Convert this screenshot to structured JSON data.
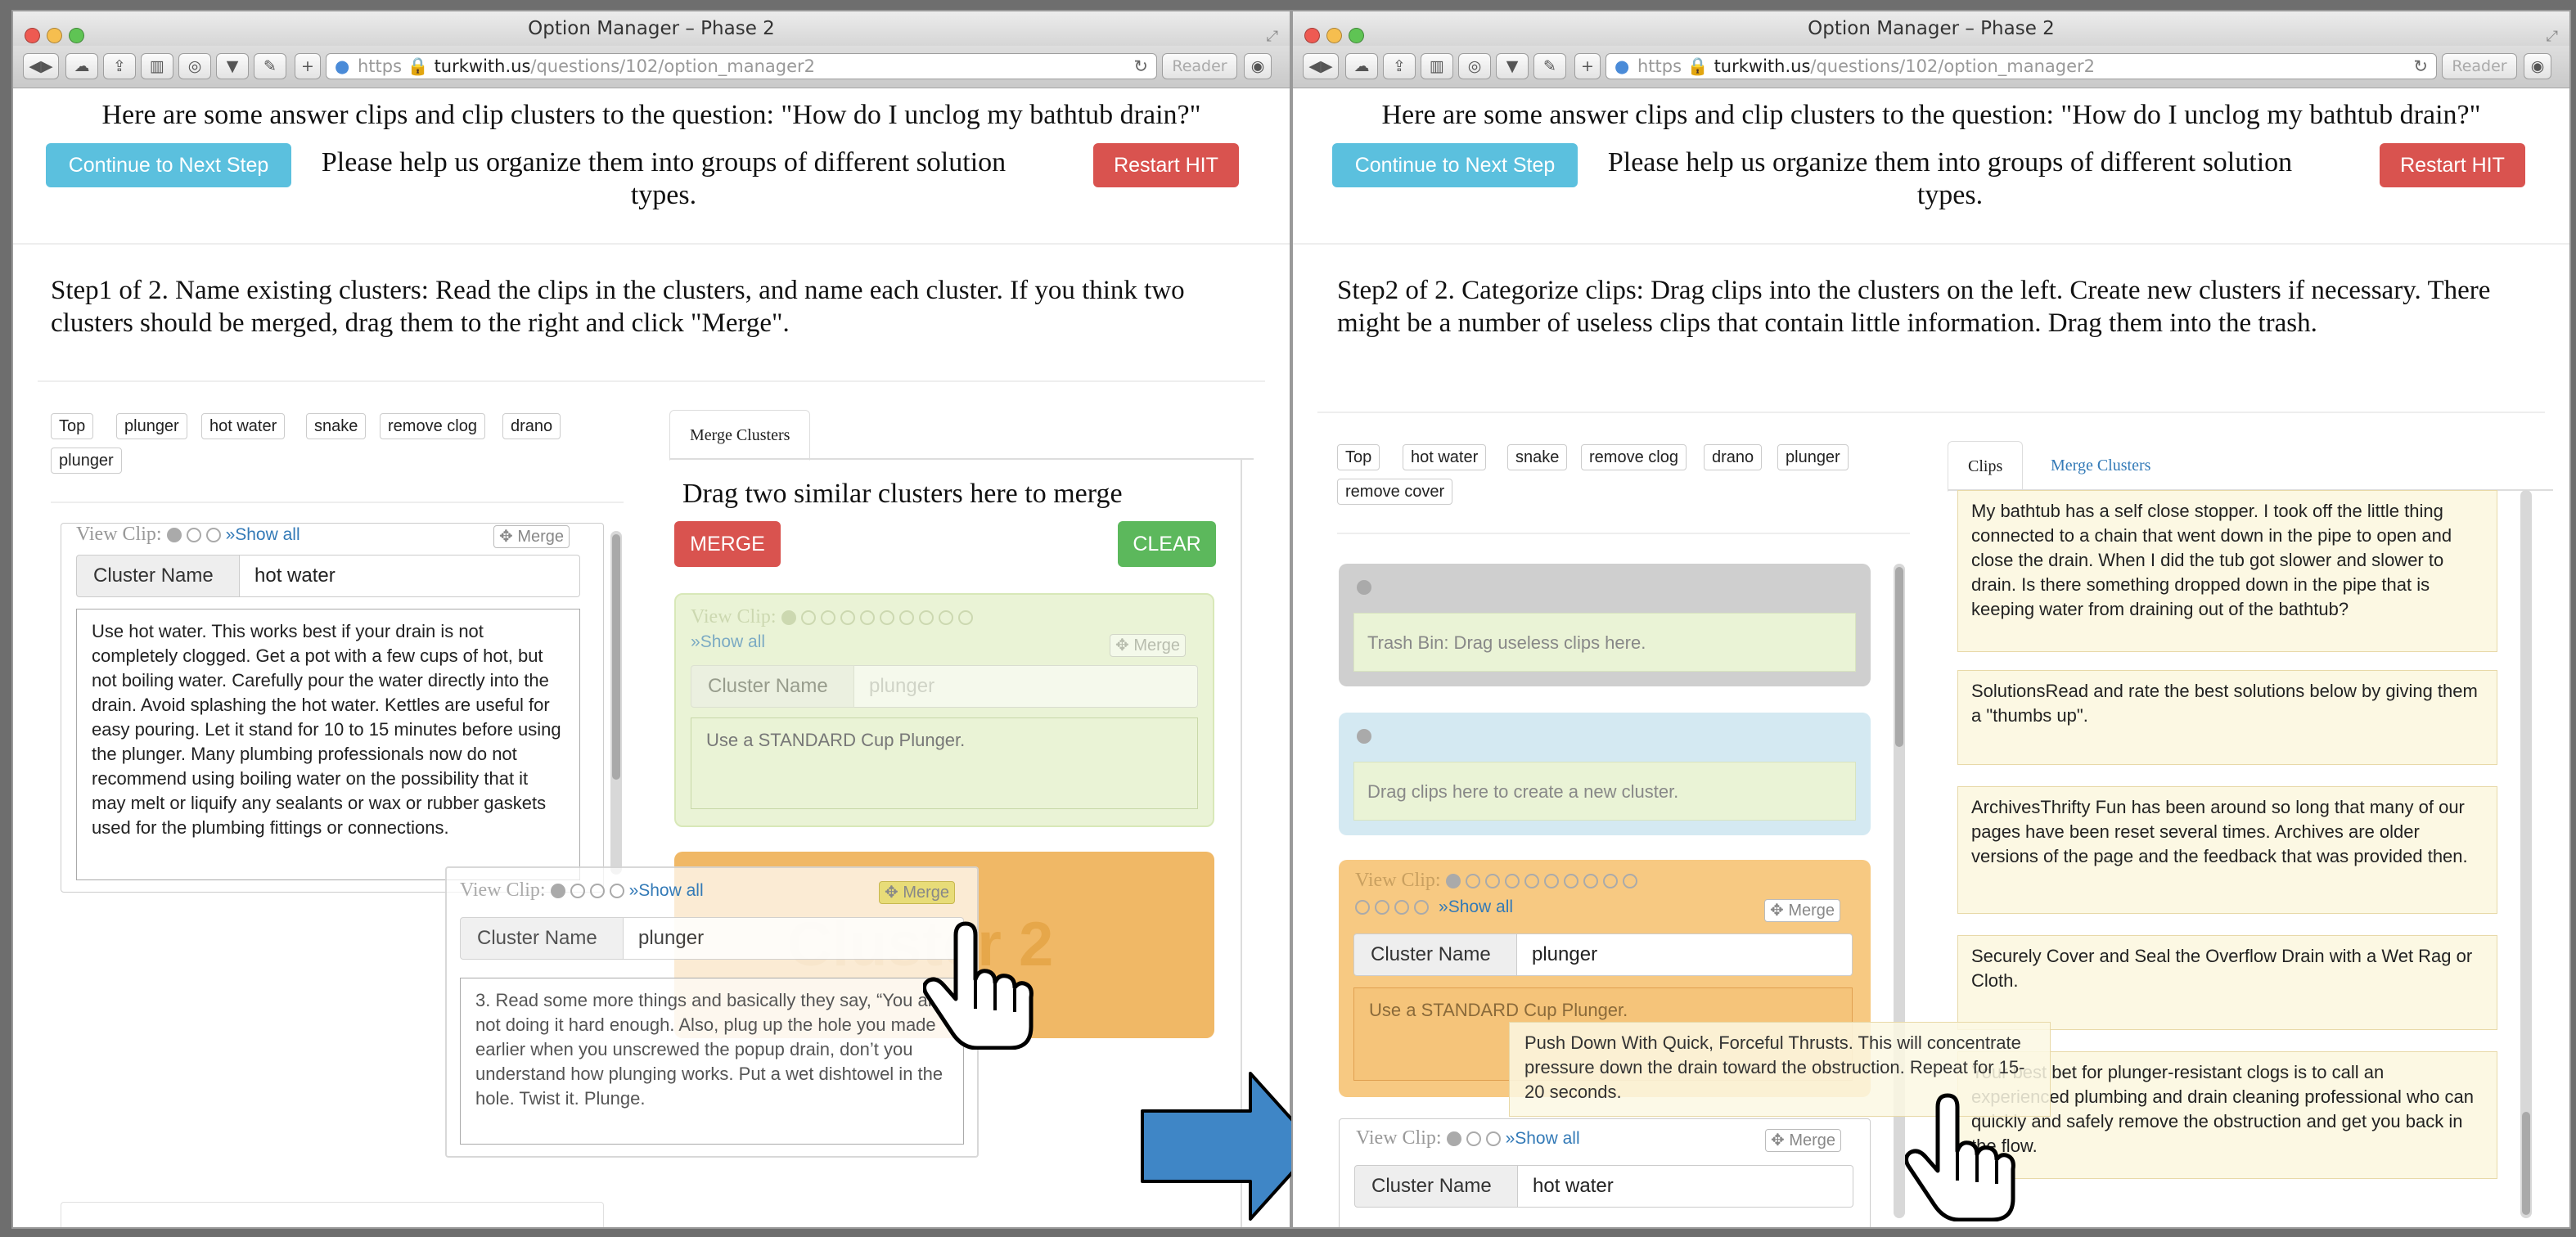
{
  "window_title": "Option Manager – Phase 2",
  "url": {
    "scheme": "https",
    "host": "turkwith.us",
    "path": "/questions/102/option_manager2"
  },
  "reader_label": "Reader",
  "question": "Here are some answer clips and clip clusters to the question: \"How do I unclog my bathtub drain?\"",
  "instruction": "Please help us organize them into groups of different solution types.",
  "continue_label": "Continue to Next Step",
  "restart_label": "Restart HIT",
  "left": {
    "step_text": "Step1 of 2. Name existing clusters: Read the clips in the clusters, and name each cluster. If you think two clusters should be merged, drag them to the right and click \"Merge\".",
    "tags": [
      "Top",
      "plunger",
      "hot water",
      "snake",
      "remove clog",
      "drano",
      "plunger"
    ],
    "view_clip_label": "View Clip:",
    "show_all": "Show all",
    "merge_small": "Merge",
    "cluster_name_label": "Cluster Name",
    "hot_water_cluster": {
      "name": "hot water",
      "clip": "Use hot water. This works best if your drain is not completely clogged. Get a pot with a few cups of hot, but not boiling water. Carefully pour the water directly into the drain. Avoid splashing the hot water. Kettles are useful for easy pouring. Let it stand for 10 to 15 minutes before using the plunger. Many plumbing professionals now do not recommend using boiling water on the possibility that it may melt or liquify any sealants or wax or rubber gaskets used for the plumbing fittings or connections."
    },
    "dragged_cluster": {
      "name": "plunger",
      "clip": "3. Read some more things and basically they say, “You are not doing it hard enough. Also, plug up the hole you made earlier when you unscrewed the popup drain, don’t you understand how plunging works. Put a wet dishtowel in the hole. Twist it. Plunge."
    },
    "merge_tab": "Merge Clusters",
    "drag_hint": "Drag two similar clusters here to merge",
    "merge_btn": "MERGE",
    "clear_btn": "CLEAR",
    "green_cluster": {
      "placeholder": "plunger",
      "clip": "Use a STANDARD Cup Plunger."
    },
    "orange_watermark": "Cluster 2"
  },
  "right": {
    "step_text": "Step2 of 2. Categorize clips: Drag clips into the clusters on the left. Create new clusters if necessary. There might be a number of useless clips that contain little information. Drag them into the trash.",
    "tags": [
      "Top",
      "hot water",
      "snake",
      "remove clog",
      "drano",
      "plunger",
      "remove cover"
    ],
    "trash_text": "Trash Bin: Drag useless clips here.",
    "new_cluster_text": "Drag clips here to create a new cluster.",
    "plunger_cluster": {
      "name": "plunger",
      "clip": "Use a STANDARD Cup Plunger."
    },
    "hot_water_cluster": {
      "name": "hot water"
    },
    "dragged_clip": "Push Down With Quick, Forceful Thrusts. This will concentrate pressure down the drain toward the obstruction. Repeat for 15-20 seconds.",
    "tab_clips": "Clips",
    "tab_merge": "Merge Clusters",
    "clips": [
      "My bathtub has a self close stopper. I took off the little thing connected to a chain that went down in the pipe to open and close the drain. When I did the tub got slower and slower to drain. Is there something dropped down in the pipe that is keeping water from draining out of the bathtub?",
      "SolutionsRead and rate the best solutions below by giving them a \"thumbs up\".",
      "ArchivesThrifty Fun has been around so long that many of our pages have been reset several times. Archives are older versions of the page and the feedback that was provided then.",
      "Securely Cover and Seal the Overflow Drain with a Wet Rag or Cloth.",
      "Your best bet for plunger-resistant clogs is to call an experienced plumbing and drain cleaning professional who can quickly and safely remove the obstruction and get you back in the flow."
    ]
  },
  "colors": {
    "info": "#5bc0de",
    "danger": "#d9534f",
    "success": "#5cb85c",
    "arrow": "#3f86c6",
    "green_card": "#eaf3d6",
    "orange_card": "#f0b866",
    "clip_yellow": "#fcf8e3"
  }
}
